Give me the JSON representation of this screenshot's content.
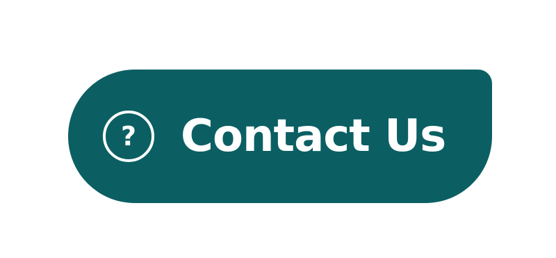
{
  "contact_button": {
    "label": "Contact Us",
    "icon": "help-circle-icon",
    "icon_glyph": "?",
    "background_color": "#0b5f63",
    "text_color": "#ffffff"
  }
}
